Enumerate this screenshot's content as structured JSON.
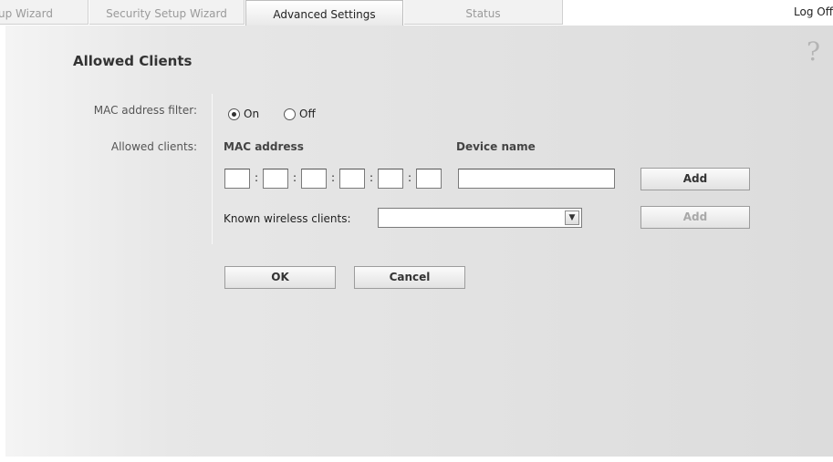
{
  "tabs": [
    {
      "label": "up Wizard",
      "active": false
    },
    {
      "label": "Security Setup Wizard",
      "active": false
    },
    {
      "label": "Advanced Settings",
      "active": true
    },
    {
      "label": "Status",
      "active": false
    }
  ],
  "header": {
    "logoff_label": "Log Off"
  },
  "help_symbol": "?",
  "page": {
    "title": "Allowed Clients"
  },
  "mac_filter": {
    "label": "MAC address filter:",
    "options": [
      {
        "label": "On",
        "selected": true
      },
      {
        "label": "Off",
        "selected": false
      }
    ]
  },
  "allowed_clients": {
    "label": "Allowed clients:",
    "col_mac": "MAC address",
    "col_device": "Device name",
    "mac_octets": [
      "",
      "",
      "",
      "",
      "",
      ""
    ],
    "separator": ":",
    "device_name_value": "",
    "add_label": "Add",
    "known_label": "Known wireless clients:",
    "known_selected": "",
    "known_add_label": "Add"
  },
  "actions": {
    "ok_label": "OK",
    "cancel_label": "Cancel"
  },
  "colors": {
    "panel_bg": "#e0e0e0",
    "active_tab_text": "#222222",
    "inactive_tab_text": "#9a9a9a"
  }
}
